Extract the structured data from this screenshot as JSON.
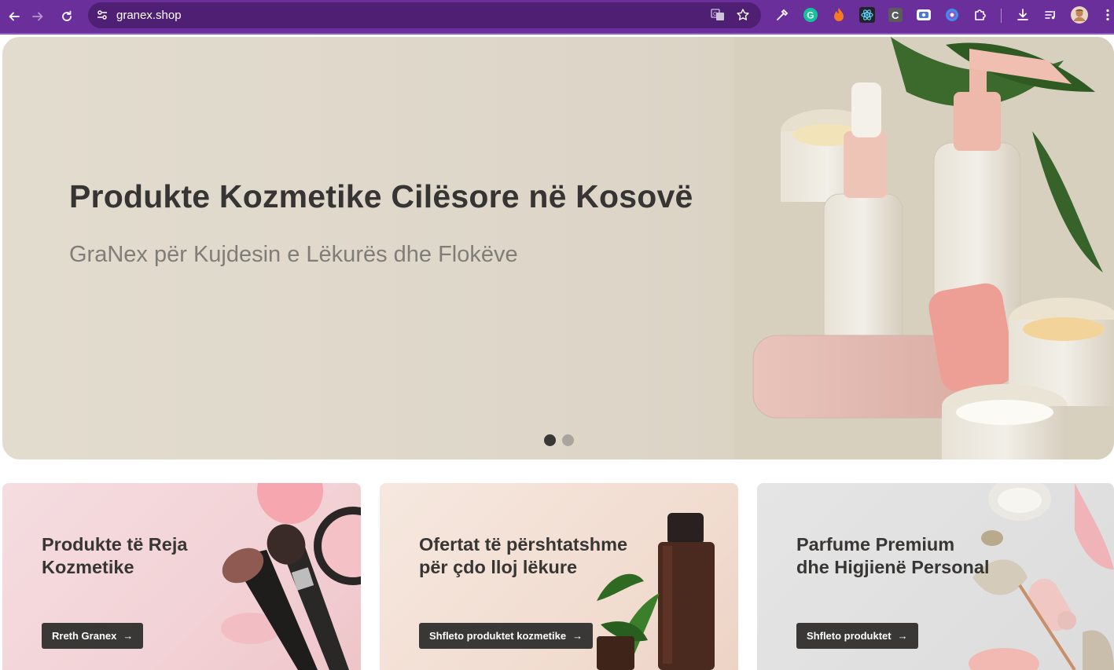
{
  "browser": {
    "url": "granex.shop",
    "accent": "#6a2f9a",
    "extensions": [
      "eyedropper-icon",
      "grammarly-icon",
      "fire-extension-icon",
      "react-devtools-icon",
      "c-extension-icon",
      "screen-capture-icon",
      "circle-extension-icon",
      "puzzle-icon"
    ]
  },
  "hero": {
    "title": "Produkte Kozmetike Cilësore në Kosovë",
    "subtitle": "GraNex për Kujdesin e Lëkurës dhe Flokëve",
    "slides_count": 2,
    "active_slide": 1
  },
  "cards": [
    {
      "title_line1": "Produkte të Reja",
      "title_line2": "Kozmetike",
      "button": "Rreth Granex"
    },
    {
      "title_line1": "Ofertat të përshtatshme",
      "title_line2": "për çdo lloj lëkure",
      "button": "Shfleto produktet kozmetike"
    },
    {
      "title_line1": "Parfume Premium",
      "title_line2": "dhe Higjienë Personal",
      "button": "Shfleto produktet"
    }
  ],
  "colors": {
    "button_bg": "#3a3836",
    "title_text": "#373534",
    "subtitle_text": "#807d79"
  }
}
